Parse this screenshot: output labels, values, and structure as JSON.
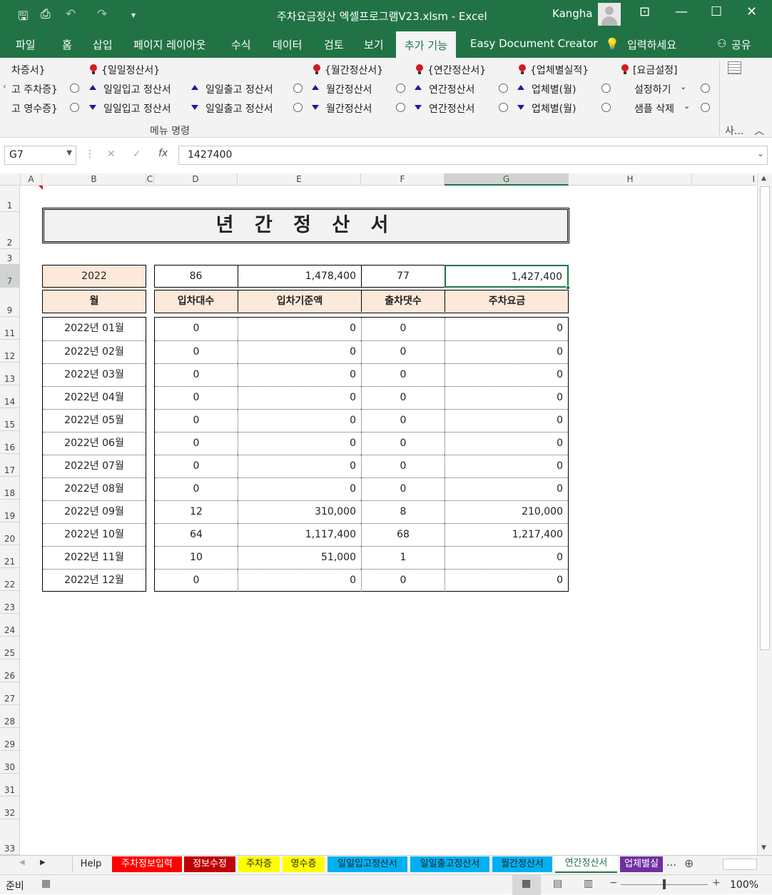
{
  "window": {
    "title": "주차요금정산 엑셀프로그램V23.xlsm  -  Excel",
    "user": "Kangha"
  },
  "ribbon_tabs": [
    "파일",
    "홈",
    "삽입",
    "페이지 레이아웃",
    "수식",
    "데이터",
    "검토",
    "보기",
    "추가 기능",
    "Easy Document Creator",
    "입력하세요",
    "공유"
  ],
  "ribbon": {
    "row1": [
      "차증서}",
      "{일일정산서}",
      "{월간정산서}",
      "{연간정산서}",
      "{업체별실적}",
      "[요금설정]"
    ],
    "row2": [
      "고 주차증}",
      "일일입고 정산서",
      "일일출고 정산서",
      "월간정산서",
      "연간정산서",
      "업체별(월)",
      "설정하기"
    ],
    "row3": [
      "고 영수증}",
      "일일입고 정산서",
      "일일출고 정산서",
      "월간정산서",
      "연간정산서",
      "업체별(월)",
      "샘플 삭제"
    ],
    "group_label": "메뉴 명령",
    "side_label": "사..."
  },
  "formula": {
    "name_box": "G7",
    "value": "1427400"
  },
  "columns": [
    "A",
    "B",
    "C",
    "D",
    "E",
    "F",
    "G",
    "H",
    "I"
  ],
  "rows": [
    "1",
    "2",
    "3",
    "7",
    "9",
    "11",
    "12",
    "13",
    "14",
    "15",
    "16",
    "17",
    "18",
    "19",
    "20",
    "21",
    "22",
    "23",
    "24",
    "25",
    "26",
    "27",
    "28",
    "29",
    "30",
    "31",
    "32",
    "33"
  ],
  "report": {
    "title": "년 간 정 산 서",
    "year": "2022",
    "totals": {
      "count_in": "86",
      "amount_in": "1,478,400",
      "count_out": "77",
      "fee": "1,427,400"
    },
    "headers": [
      "월",
      "입차대수",
      "입차기준액",
      "출차댓수",
      "주차요금"
    ],
    "months": [
      {
        "month": "2022년 01월",
        "count_in": "0",
        "amount_in": "0",
        "count_out": "0",
        "fee": "0"
      },
      {
        "month": "2022년 02월",
        "count_in": "0",
        "amount_in": "0",
        "count_out": "0",
        "fee": "0"
      },
      {
        "month": "2022년 03월",
        "count_in": "0",
        "amount_in": "0",
        "count_out": "0",
        "fee": "0"
      },
      {
        "month": "2022년 04월",
        "count_in": "0",
        "amount_in": "0",
        "count_out": "0",
        "fee": "0"
      },
      {
        "month": "2022년 05월",
        "count_in": "0",
        "amount_in": "0",
        "count_out": "0",
        "fee": "0"
      },
      {
        "month": "2022년 06월",
        "count_in": "0",
        "amount_in": "0",
        "count_out": "0",
        "fee": "0"
      },
      {
        "month": "2022년 07월",
        "count_in": "0",
        "amount_in": "0",
        "count_out": "0",
        "fee": "0"
      },
      {
        "month": "2022년 08월",
        "count_in": "0",
        "amount_in": "0",
        "count_out": "0",
        "fee": "0"
      },
      {
        "month": "2022년 09월",
        "count_in": "12",
        "amount_in": "310,000",
        "count_out": "8",
        "fee": "210,000"
      },
      {
        "month": "2022년 10월",
        "count_in": "64",
        "amount_in": "1,117,400",
        "count_out": "68",
        "fee": "1,217,400"
      },
      {
        "month": "2022년 11월",
        "count_in": "10",
        "amount_in": "51,000",
        "count_out": "1",
        "fee": "0"
      },
      {
        "month": "2022년 12월",
        "count_in": "0",
        "amount_in": "0",
        "count_out": "0",
        "fee": "0"
      }
    ]
  },
  "sheet_tabs": [
    {
      "label": "Help",
      "color": "#f3f3f3",
      "text": "#222"
    },
    {
      "label": "주차정보입력",
      "color": "#ff0000",
      "text": "#ffffff"
    },
    {
      "label": "정보수정",
      "color": "#c00000",
      "text": "#ffffff"
    },
    {
      "label": "주차증",
      "color": "#ffff00",
      "text": "#222"
    },
    {
      "label": "영수증",
      "color": "#ffff00",
      "text": "#222"
    },
    {
      "label": "일일입고정산서",
      "color": "#00b0f0",
      "text": "#222"
    },
    {
      "label": "일일출고정산서",
      "color": "#00b0f0",
      "text": "#222"
    },
    {
      "label": "월간정산서",
      "color": "#00b0f0",
      "text": "#222"
    },
    {
      "label": "연간정산서",
      "color": "#ffffff",
      "text": "#217346"
    },
    {
      "label": "업체별실",
      "color": "#7030a0",
      "text": "#ffffff"
    }
  ],
  "status": {
    "ready": "준비",
    "zoom": "100%"
  }
}
